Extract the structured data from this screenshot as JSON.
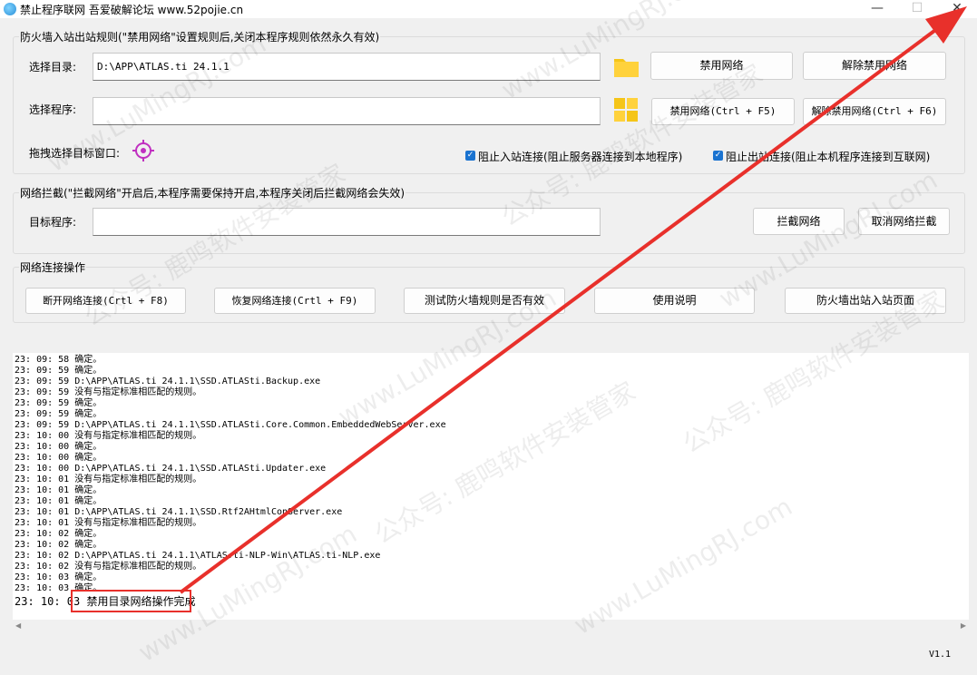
{
  "window": {
    "title": "禁止程序联网 吾爱破解论坛 www.52pojie.cn",
    "minimize": "—",
    "maximize": "☐",
    "close": "✕"
  },
  "firewall_group": {
    "title": "防火墙入站出站规则(\"禁用网络\"设置规则后,关闭本程序规则依然永久有效)",
    "dir_label": "选择目录:",
    "dir_value": "D:\\APP\\ATLAS.ti 24.1.1",
    "prog_label": "选择程序:",
    "prog_value": "",
    "drag_label": "拖拽选择目标窗口:",
    "btn_disable_net": "禁用网络",
    "btn_enable_net": "解除禁用网络",
    "btn_disable_net_hotkey": "禁用网络(Ctrl + F5)",
    "btn_enable_net_hotkey": "解除禁用网络(Ctrl + F6)",
    "chk_inbound": "阻止入站连接(阻止服务器连接到本地程序)",
    "chk_outbound": "阻止出站连接(阻止本机程序连接到互联网)"
  },
  "intercept_group": {
    "title": "网络拦截(\"拦截网络\"开启后,本程序需要保持开启,本程序关闭后拦截网络会失效)",
    "target_label": "目标程序:",
    "target_value": "",
    "btn_intercept": "拦截网络",
    "btn_cancel_intercept": "取消网络拦截"
  },
  "ops_group": {
    "title": "网络连接操作",
    "btn_disconnect": "断开网络连接(Crtl + F8)",
    "btn_restore": "恢复网络连接(Crtl + F9)",
    "btn_test": "测试防火墙规则是否有效",
    "btn_help": "使用说明",
    "btn_firewall_page": "防火墙出站入站页面"
  },
  "log": [
    "23: 09: 58 确定。",
    "23: 09: 59 确定。",
    "23: 09: 59 D:\\APP\\ATLAS.ti 24.1.1\\SSD.ATLASti.Backup.exe",
    "23: 09: 59 没有与指定标准相匹配的规则。",
    "23: 09: 59 确定。",
    "23: 09: 59 确定。",
    "23: 09: 59 D:\\APP\\ATLAS.ti 24.1.1\\SSD.ATLASti.Core.Common.EmbeddedWebServer.exe",
    "23: 10: 00 没有与指定标准相匹配的规则。",
    "23: 10: 00 确定。",
    "23: 10: 00 确定。",
    "23: 10: 00 D:\\APP\\ATLAS.ti 24.1.1\\SSD.ATLASti.Updater.exe",
    "23: 10: 01 没有与指定标准相匹配的规则。",
    "23: 10: 01 确定。",
    "23: 10: 01 确定。",
    "23: 10: 01 D:\\APP\\ATLAS.ti 24.1.1\\SSD.Rtf2AHtmlConServer.exe",
    "23: 10: 01 没有与指定标准相匹配的规则。",
    "23: 10: 02 确定。",
    "23: 10: 02 确定。",
    "23: 10: 02 D:\\APP\\ATLAS.ti 24.1.1\\ATLAS.ti-NLP-Win\\ATLAS.ti-NLP.exe",
    "23: 10: 02 没有与指定标准相匹配的规则。",
    "23: 10: 03 确定。",
    "23: 10: 03 确定。",
    "23: 10: 03 禁用目录网络操作完成"
  ],
  "version": "V1.1",
  "watermark": {
    "site": "www.LuMingRJ.com",
    "name": "公众号: 鹿鸣软件安装管家"
  },
  "colors": {
    "annotation_red": "#e8302b",
    "checkbox_blue": "#1a73d0",
    "folder_yellow": "#f5c518"
  }
}
